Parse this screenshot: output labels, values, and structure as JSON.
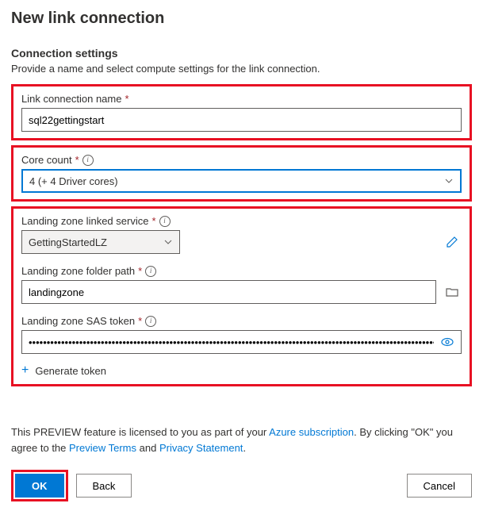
{
  "header": {
    "title": "New link connection"
  },
  "section": {
    "title": "Connection settings",
    "subtitle": "Provide a name and select compute settings for the link connection."
  },
  "fields": {
    "name": {
      "label": "Link connection name",
      "value": "sql22gettingstart"
    },
    "cores": {
      "label": "Core count",
      "value": "4 (+ 4 Driver cores)"
    },
    "lzService": {
      "label": "Landing zone linked service",
      "value": "GettingStartedLZ"
    },
    "lzPath": {
      "label": "Landing zone folder path",
      "value": "landingzone"
    },
    "lzSas": {
      "label": "Landing zone SAS token",
      "value": "•••••••••••••••••••••••••••••••••••••••••••••••••••••••••••••••••••••••••••••••••••••••••••••••••••••••••••••••••••••••••••…"
    },
    "genToken": "Generate token"
  },
  "preview": {
    "p1": "This PREVIEW feature is licensed to you as part of your ",
    "link1": "Azure subscription",
    "p2": ". By clicking \"OK\" you agree to the ",
    "link2": "Preview Terms",
    "p3": " and ",
    "link3": "Privacy Statement",
    "p4": "."
  },
  "buttons": {
    "ok": "OK",
    "back": "Back",
    "cancel": "Cancel"
  }
}
